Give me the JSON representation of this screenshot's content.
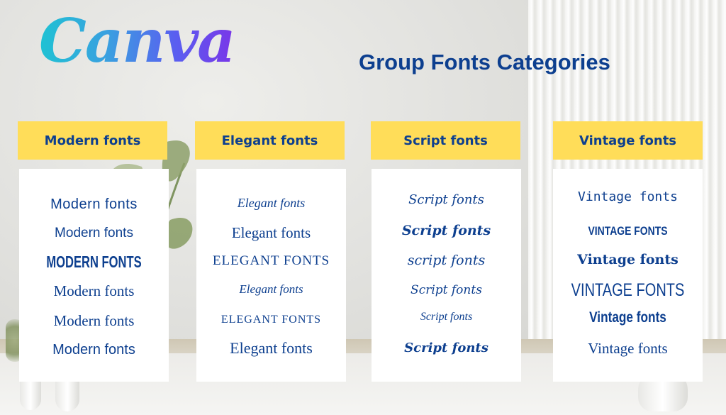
{
  "brand": {
    "logo_text": "Canva"
  },
  "page_title": "Group Fonts Categories",
  "colors": {
    "title_text": "#0d3f8f",
    "header_fill": "#ffdd59",
    "card_fill": "#ffffff",
    "logo_gradient": [
      "#1fc2d3",
      "#5a5ef0",
      "#7a36e8"
    ]
  },
  "categories": [
    {
      "title": "Modern fonts",
      "samples": [
        "Modern fonts",
        "Modern fonts",
        "MODERN FONTS",
        "Modern fonts",
        "Modern fonts",
        "Modern fonts"
      ]
    },
    {
      "title": "Elegant fonts",
      "samples": [
        "Elegant fonts",
        "Elegant fonts",
        "Elegant fonts",
        "Elegant fonts",
        "Elegant fonts",
        "Elegant fonts"
      ]
    },
    {
      "title": "Script fonts",
      "samples": [
        "Script fonts",
        "Script fonts",
        "script fonts",
        "Script fonts",
        "Script fonts",
        "Script fonts"
      ]
    },
    {
      "title": "Vintage fonts",
      "samples": [
        "Vintage fonts",
        "VINTAGE FONTS",
        "Vintage fonts",
        "VINTAGE FONTS",
        "Vintage fonts",
        "Vintage fonts"
      ]
    }
  ]
}
